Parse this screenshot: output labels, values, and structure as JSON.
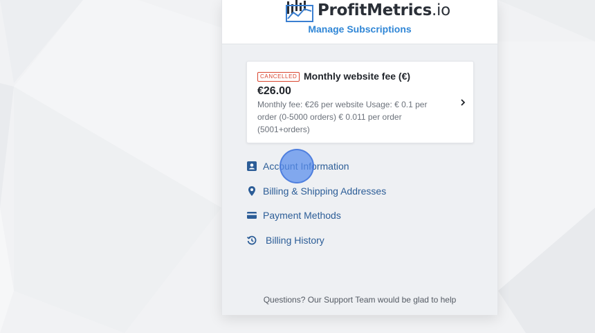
{
  "brand": {
    "name": "ProfitMetrics",
    "tld": ".io",
    "color": "#2f86d6"
  },
  "header": {
    "manage_label": "Manage Subscriptions"
  },
  "subscription": {
    "status": "CANCELLED",
    "title": "Monthly website fee (€)",
    "price": "€26.00",
    "description": "Monthly fee: €26 per website Usage: € 0.1 per order (0-5000 orders) € 0.011 per order (5001+orders)"
  },
  "menu": [
    {
      "label": "Account Information",
      "icon": "account-card-icon"
    },
    {
      "label": "Billing & Shipping Addresses",
      "icon": "map-pin-icon"
    },
    {
      "label": "Payment Methods",
      "icon": "credit-card-icon"
    },
    {
      "label": "Billing History",
      "icon": "history-icon"
    }
  ],
  "footer": {
    "support_text": "Questions? Our Support Team would be glad to help"
  },
  "colors": {
    "link": "#2c5d97",
    "accent": "#2f86d6",
    "badge": "#d9442e"
  }
}
